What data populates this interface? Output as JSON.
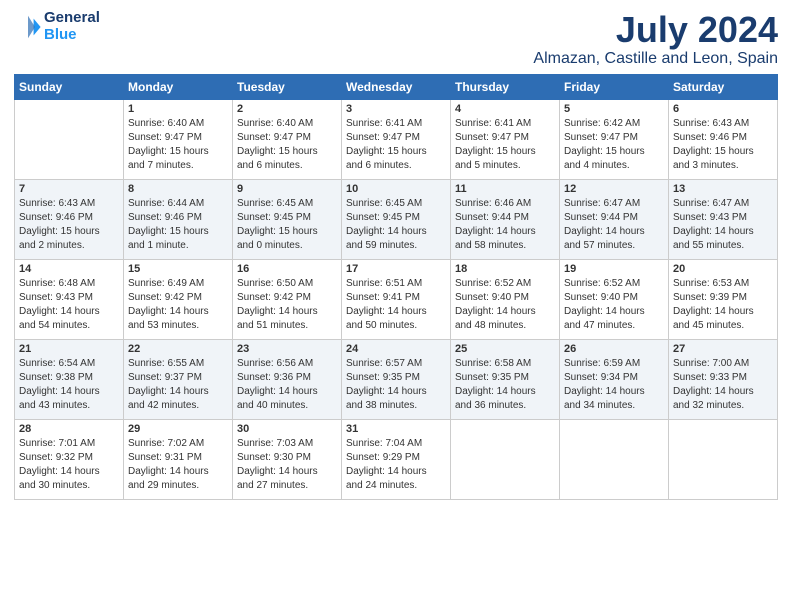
{
  "logo": {
    "line1": "General",
    "line2": "Blue"
  },
  "title": "July 2024",
  "subtitle": "Almazan, Castille and Leon, Spain",
  "headers": [
    "Sunday",
    "Monday",
    "Tuesday",
    "Wednesday",
    "Thursday",
    "Friday",
    "Saturday"
  ],
  "weeks": [
    [
      {
        "day": "",
        "info": ""
      },
      {
        "day": "1",
        "info": "Sunrise: 6:40 AM\nSunset: 9:47 PM\nDaylight: 15 hours\nand 7 minutes."
      },
      {
        "day": "2",
        "info": "Sunrise: 6:40 AM\nSunset: 9:47 PM\nDaylight: 15 hours\nand 6 minutes."
      },
      {
        "day": "3",
        "info": "Sunrise: 6:41 AM\nSunset: 9:47 PM\nDaylight: 15 hours\nand 6 minutes."
      },
      {
        "day": "4",
        "info": "Sunrise: 6:41 AM\nSunset: 9:47 PM\nDaylight: 15 hours\nand 5 minutes."
      },
      {
        "day": "5",
        "info": "Sunrise: 6:42 AM\nSunset: 9:47 PM\nDaylight: 15 hours\nand 4 minutes."
      },
      {
        "day": "6",
        "info": "Sunrise: 6:43 AM\nSunset: 9:46 PM\nDaylight: 15 hours\nand 3 minutes."
      }
    ],
    [
      {
        "day": "7",
        "info": "Sunrise: 6:43 AM\nSunset: 9:46 PM\nDaylight: 15 hours\nand 2 minutes."
      },
      {
        "day": "8",
        "info": "Sunrise: 6:44 AM\nSunset: 9:46 PM\nDaylight: 15 hours\nand 1 minute."
      },
      {
        "day": "9",
        "info": "Sunrise: 6:45 AM\nSunset: 9:45 PM\nDaylight: 15 hours\nand 0 minutes."
      },
      {
        "day": "10",
        "info": "Sunrise: 6:45 AM\nSunset: 9:45 PM\nDaylight: 14 hours\nand 59 minutes."
      },
      {
        "day": "11",
        "info": "Sunrise: 6:46 AM\nSunset: 9:44 PM\nDaylight: 14 hours\nand 58 minutes."
      },
      {
        "day": "12",
        "info": "Sunrise: 6:47 AM\nSunset: 9:44 PM\nDaylight: 14 hours\nand 57 minutes."
      },
      {
        "day": "13",
        "info": "Sunrise: 6:47 AM\nSunset: 9:43 PM\nDaylight: 14 hours\nand 55 minutes."
      }
    ],
    [
      {
        "day": "14",
        "info": "Sunrise: 6:48 AM\nSunset: 9:43 PM\nDaylight: 14 hours\nand 54 minutes."
      },
      {
        "day": "15",
        "info": "Sunrise: 6:49 AM\nSunset: 9:42 PM\nDaylight: 14 hours\nand 53 minutes."
      },
      {
        "day": "16",
        "info": "Sunrise: 6:50 AM\nSunset: 9:42 PM\nDaylight: 14 hours\nand 51 minutes."
      },
      {
        "day": "17",
        "info": "Sunrise: 6:51 AM\nSunset: 9:41 PM\nDaylight: 14 hours\nand 50 minutes."
      },
      {
        "day": "18",
        "info": "Sunrise: 6:52 AM\nSunset: 9:40 PM\nDaylight: 14 hours\nand 48 minutes."
      },
      {
        "day": "19",
        "info": "Sunrise: 6:52 AM\nSunset: 9:40 PM\nDaylight: 14 hours\nand 47 minutes."
      },
      {
        "day": "20",
        "info": "Sunrise: 6:53 AM\nSunset: 9:39 PM\nDaylight: 14 hours\nand 45 minutes."
      }
    ],
    [
      {
        "day": "21",
        "info": "Sunrise: 6:54 AM\nSunset: 9:38 PM\nDaylight: 14 hours\nand 43 minutes."
      },
      {
        "day": "22",
        "info": "Sunrise: 6:55 AM\nSunset: 9:37 PM\nDaylight: 14 hours\nand 42 minutes."
      },
      {
        "day": "23",
        "info": "Sunrise: 6:56 AM\nSunset: 9:36 PM\nDaylight: 14 hours\nand 40 minutes."
      },
      {
        "day": "24",
        "info": "Sunrise: 6:57 AM\nSunset: 9:35 PM\nDaylight: 14 hours\nand 38 minutes."
      },
      {
        "day": "25",
        "info": "Sunrise: 6:58 AM\nSunset: 9:35 PM\nDaylight: 14 hours\nand 36 minutes."
      },
      {
        "day": "26",
        "info": "Sunrise: 6:59 AM\nSunset: 9:34 PM\nDaylight: 14 hours\nand 34 minutes."
      },
      {
        "day": "27",
        "info": "Sunrise: 7:00 AM\nSunset: 9:33 PM\nDaylight: 14 hours\nand 32 minutes."
      }
    ],
    [
      {
        "day": "28",
        "info": "Sunrise: 7:01 AM\nSunset: 9:32 PM\nDaylight: 14 hours\nand 30 minutes."
      },
      {
        "day": "29",
        "info": "Sunrise: 7:02 AM\nSunset: 9:31 PM\nDaylight: 14 hours\nand 29 minutes."
      },
      {
        "day": "30",
        "info": "Sunrise: 7:03 AM\nSunset: 9:30 PM\nDaylight: 14 hours\nand 27 minutes."
      },
      {
        "day": "31",
        "info": "Sunrise: 7:04 AM\nSunset: 9:29 PM\nDaylight: 14 hours\nand 24 minutes."
      },
      {
        "day": "",
        "info": ""
      },
      {
        "day": "",
        "info": ""
      },
      {
        "day": "",
        "info": ""
      }
    ]
  ]
}
